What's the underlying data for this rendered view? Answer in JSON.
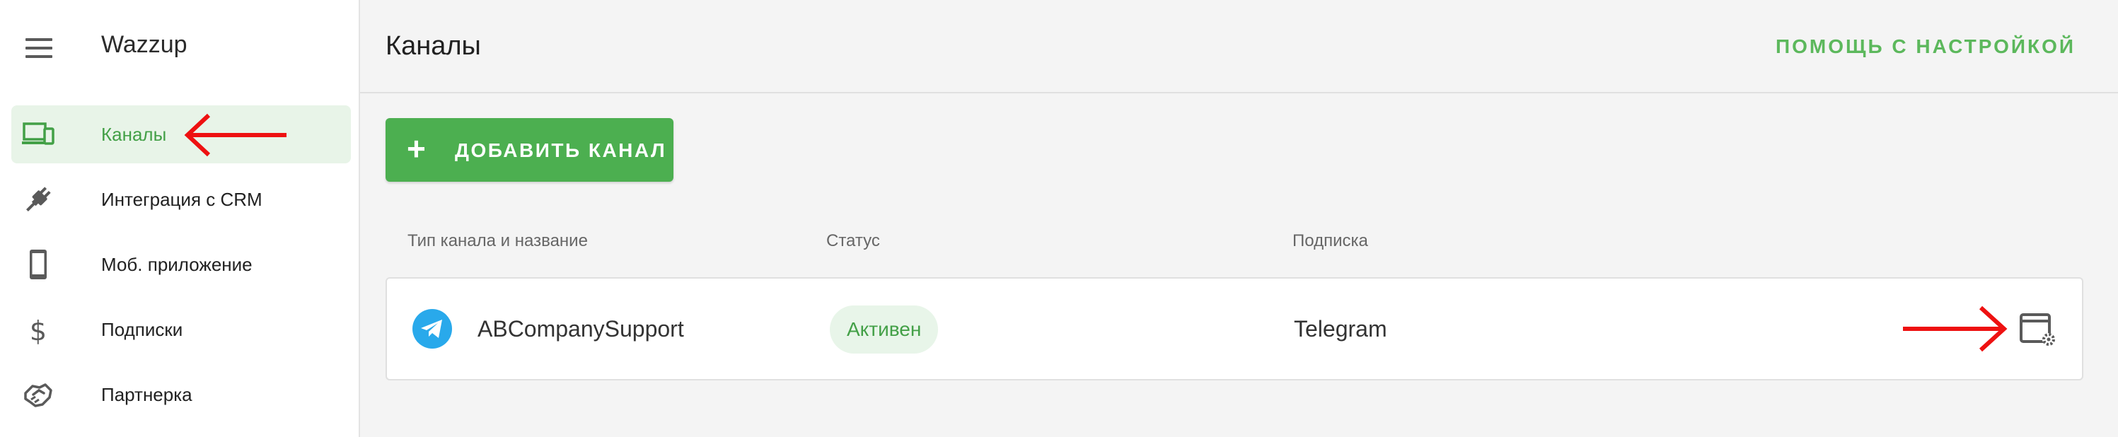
{
  "app": {
    "title": "Wazzup"
  },
  "sidebar": {
    "items": [
      {
        "label": "Каналы",
        "icon": "devices-icon",
        "active": true
      },
      {
        "label": "Интеграция с CRM",
        "icon": "plug-icon"
      },
      {
        "label": "Моб. приложение",
        "icon": "smartphone-icon"
      },
      {
        "label": "Подписки",
        "icon": "dollar-icon"
      },
      {
        "label": "Партнерка",
        "icon": "handshake-icon"
      }
    ]
  },
  "header": {
    "title": "Каналы",
    "help_label": "ПОМОЩЬ С НАСТРОЙКОЙ"
  },
  "toolbar": {
    "add_label": "ДОБАВИТЬ КАНАЛ"
  },
  "table": {
    "columns": [
      "Тип канала и название",
      "Статус",
      "Подписка"
    ],
    "rows": [
      {
        "channel_icon": "telegram-icon",
        "name": "ABCompanySupport",
        "status": "Активен",
        "subscription": "Telegram"
      }
    ]
  },
  "colors": {
    "accent": "#4caf50",
    "accent_text": "#43a047",
    "active_bg": "#e8f4e8",
    "annotation_arrow": "#ee1111",
    "telegram": "#29a9eb"
  }
}
